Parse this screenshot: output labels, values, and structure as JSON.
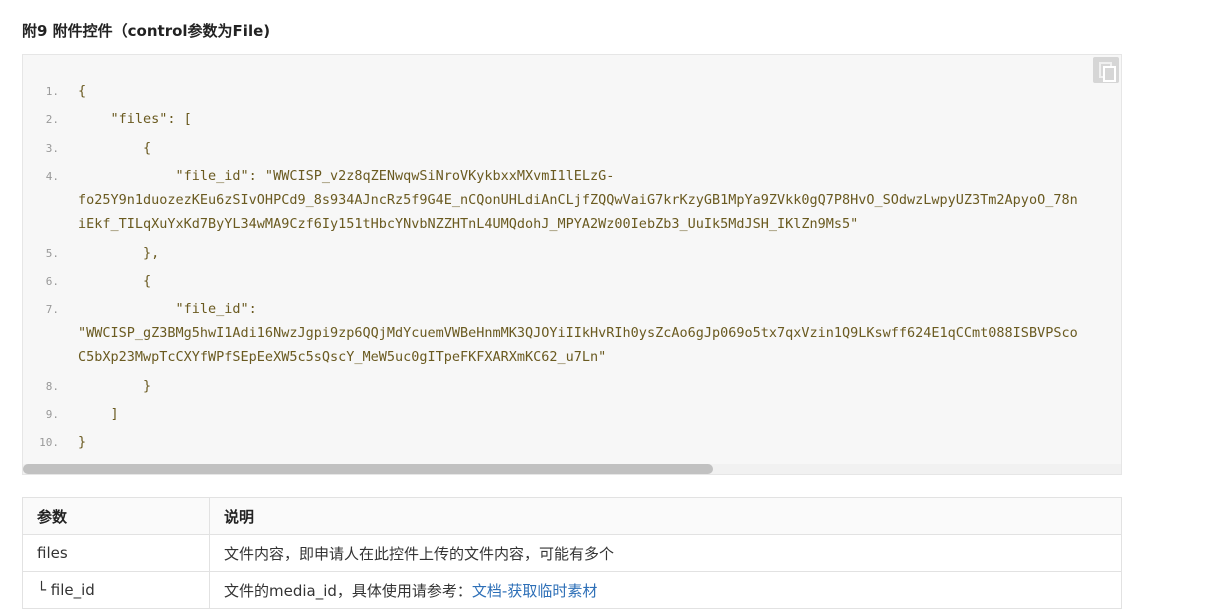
{
  "heading": "附9 附件控件（control参数为File)",
  "code": {
    "lines": [
      {
        "num": "1.",
        "text": "{"
      },
      {
        "num": "2.",
        "text": "    \"files\": ["
      },
      {
        "num": "3.",
        "text": "        {"
      },
      {
        "num": "4.",
        "text": "            \"file_id\": \"WWCISP_v2z8qZENwqwSiNroVKykbxxMXvmI1lELzG-"
      },
      {
        "num": "",
        "text": "fo25Y9n1duozezKEu6zSIvOHPCd9_8s934AJncRz5f9G4E_nCQonUHLdiAnCLjfZQQwVaiG7krKzyGB1MpYa9ZVkk0gQ7P8HvO_SOdwzLwpyUZ3Tm2ApyoO_78n"
      },
      {
        "num": "",
        "text": "iEkf_TILqXuYxKd7ByYL34wMA9Czf6Iy151tHbcYNvbNZZHTnL4UMQdohJ_MPYA2Wz00IebZb3_UuIk5MdJSH_IKlZn9Ms5\""
      },
      {
        "num": "5.",
        "text": "        },"
      },
      {
        "num": "6.",
        "text": "        {"
      },
      {
        "num": "7.",
        "text": "            \"file_id\":"
      },
      {
        "num": "",
        "text": "\"WWCISP_gZ3BMg5hwI1Adi16NwzJgpi9zp6QQjMdYcuemVWBeHnmMK3QJOYiIIkHvRIh0ysZcAo6gJp069o5tx7qxVzin1Q9LKswff624E1qCCmt088ISBVPSco"
      },
      {
        "num": "",
        "text": "C5bXp23MwpTcCXYfWPfSEpEeXW5c5sQscY_MeW5uc0gITpeFKFXARXmKC62_u7Ln\""
      },
      {
        "num": "8.",
        "text": "        }"
      },
      {
        "num": "9.",
        "text": "    ]"
      },
      {
        "num": "10.",
        "text": "}"
      }
    ]
  },
  "table": {
    "headers": [
      "参数",
      "说明"
    ],
    "rows": [
      {
        "param": "files",
        "desc": "文件内容，即申请人在此控件上传的文件内容，可能有多个",
        "link": ""
      },
      {
        "param": "└ file_id",
        "desc": "文件的media_id，具体使用请参考：",
        "link": "文档-获取临时素材"
      }
    ]
  },
  "icons": {
    "copy": "copy-icon"
  }
}
